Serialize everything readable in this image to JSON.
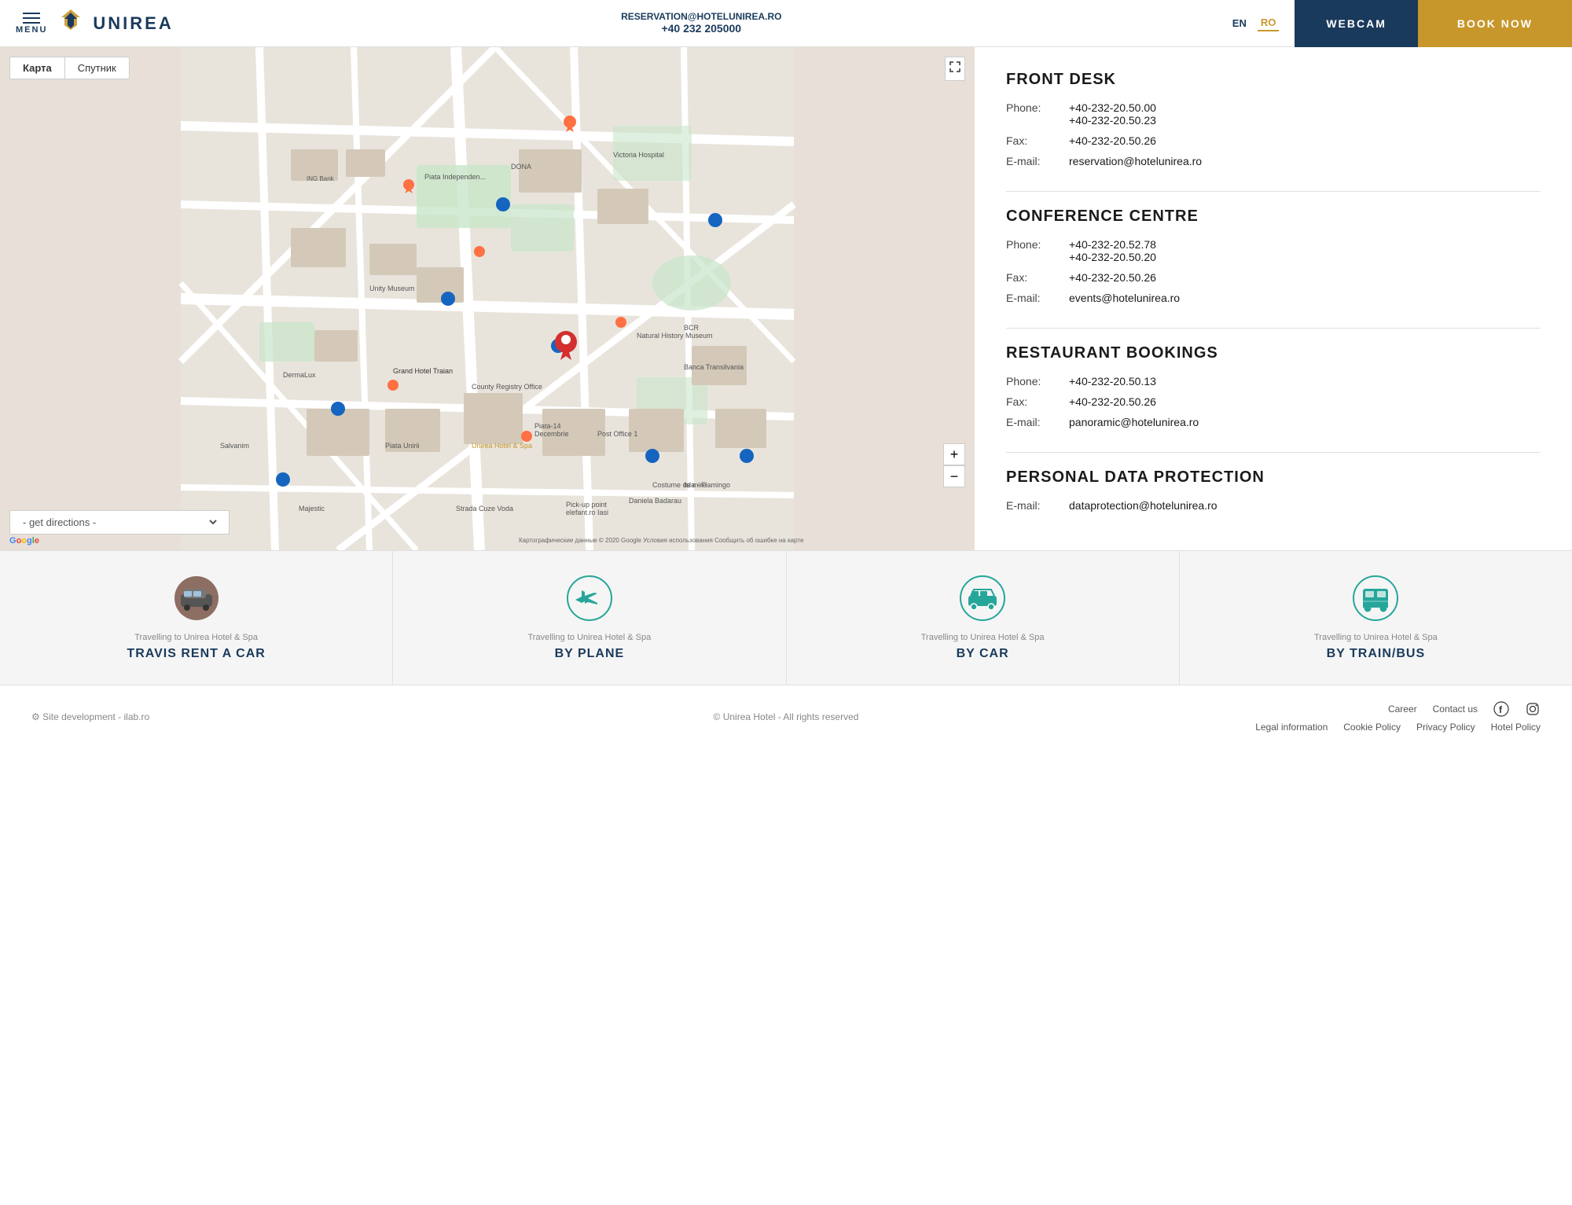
{
  "header": {
    "menu_label": "MENU",
    "logo_text": "UNIREA",
    "email": "RESERVATION@HOTELUNIREA.RO",
    "phone": "+40 232 205000",
    "lang_en": "EN",
    "lang_ro": "RO",
    "webcam_label": "WEBCAM",
    "booknow_label": "BOOK NOW"
  },
  "map": {
    "tab_map": "Карта",
    "tab_satellite": "Спутник",
    "directions_placeholder": "- get directions -",
    "zoom_in": "+",
    "zoom_out": "−",
    "google_text": "Google"
  },
  "contact": {
    "front_desk": {
      "title": "FRONT DESK",
      "phone_label": "Phone:",
      "phone1": "+40-232-20.50.00",
      "phone2": "+40-232-20.50.23",
      "fax_label": "Fax:",
      "fax": "+40-232-20.50.26",
      "email_label": "E-mail:",
      "email": "reservation@hotelunirea.ro"
    },
    "conference": {
      "title": "CONFERENCE CENTRE",
      "phone_label": "Phone:",
      "phone1": "+40-232-20.52.78",
      "phone2": "+40-232-20.50.20",
      "fax_label": "Fax:",
      "fax": "+40-232-20.50.26",
      "email_label": "E-mail:",
      "email": "events@hotelunirea.ro"
    },
    "restaurant": {
      "title": "RESTAURANT BOOKINGS",
      "phone_label": "Phone:",
      "phone": "+40-232-20.50.13",
      "fax_label": "Fax:",
      "fax": "+40-232-20.50.26",
      "email_label": "E-mail:",
      "email": "panoramic@hotelunirea.ro"
    },
    "data_protection": {
      "title": "PERSONAL DATA PROTECTION",
      "email_label": "E-mail:",
      "email": "dataprotection@hotelunirea.ro"
    }
  },
  "travel": {
    "items": [
      {
        "subtitle": "Travelling to Unirea Hotel & Spa",
        "title": "TRAVIS RENT A CAR",
        "icon_type": "car-photo"
      },
      {
        "subtitle": "Travelling to Unirea Hotel & Spa",
        "title": "BY PLANE",
        "icon_type": "plane"
      },
      {
        "subtitle": "Travelling to Unirea Hotel & Spa",
        "title": "BY CAR",
        "icon_type": "car"
      },
      {
        "subtitle": "Travelling to Unirea Hotel & Spa",
        "title": "BY TRAIN/BUS",
        "icon_type": "bus"
      }
    ]
  },
  "footer": {
    "site_dev": "⚙ Site development - ilab.ro",
    "copyright": "© Unirea Hotel - All rights reserved",
    "links_top": [
      "Career",
      "Contact us"
    ],
    "social": [
      "f",
      "instagram"
    ],
    "links_bottom": [
      "Legal information",
      "Cookie Policy",
      "Privacy Policy",
      "Hotel Policy"
    ]
  }
}
